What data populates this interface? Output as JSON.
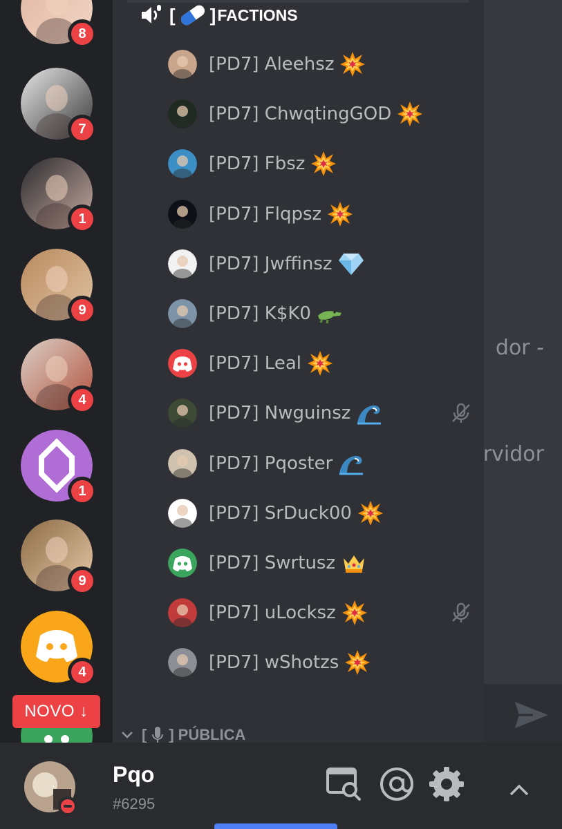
{
  "servers": [
    {
      "name": "server-1",
      "badge": "8",
      "colors": [
        "#e0b6a0",
        "#f3d7c8"
      ]
    },
    {
      "name": "server-2",
      "badge": "7",
      "colors": [
        "#e6e6e6",
        "#3a3a3a"
      ]
    },
    {
      "name": "server-3",
      "badge": "1",
      "colors": [
        "#2a2a2e",
        "#c7aaa0"
      ]
    },
    {
      "name": "server-4",
      "badge": "9",
      "colors": [
        "#b88a5e",
        "#e0c2a2"
      ]
    },
    {
      "name": "server-5",
      "badge": "4",
      "colors": [
        "#d9cfc6",
        "#b3533e"
      ]
    },
    {
      "name": "server-6",
      "badge": "1",
      "colors": [
        "#b06dd6",
        "#c987e6"
      ]
    },
    {
      "name": "server-7",
      "badge": "9",
      "colors": [
        "#8a6b45",
        "#e9c9a8"
      ]
    },
    {
      "name": "server-8",
      "badge": "4",
      "colors": [
        "#faa61a",
        "#faa61a"
      ]
    }
  ],
  "novo_label": "NOVO ↓",
  "channel": {
    "name": "FACTIONS"
  },
  "members": [
    {
      "name": "[PD7] Aleehsz",
      "emoji": "collision",
      "avatar": "#c9a58c",
      "muted": false
    },
    {
      "name": "[PD7] ChwqtingGOD",
      "emoji": "collision",
      "avatar": "#1f2a22",
      "muted": false
    },
    {
      "name": "[PD7] Fbsz",
      "emoji": "collision",
      "avatar": "#3b8fc4",
      "muted": false
    },
    {
      "name": "[PD7] Flqpsz",
      "emoji": "collision",
      "avatar": "#0d1117",
      "muted": false
    },
    {
      "name": "[PD7] Jwffinsz",
      "emoji": "gem",
      "avatar": "#f2f2f2",
      "muted": false
    },
    {
      "name": "[PD7] K$K0",
      "emoji": "crocodile",
      "avatar": "#7c93a8",
      "muted": false
    },
    {
      "name": "[PD7] Leal",
      "emoji": "collision",
      "avatar": "#ed4245",
      "muted": false
    },
    {
      "name": "[PD7] Nwguinsz",
      "emoji": "wave",
      "avatar": "#3d4a35",
      "muted": true
    },
    {
      "name": "[PD7] Pqoster",
      "emoji": "wave",
      "avatar": "#cfc3b0",
      "muted": false
    },
    {
      "name": "[PD7] SrDuck00",
      "emoji": "collision",
      "avatar": "#ffffff",
      "muted": false
    },
    {
      "name": "[PD7] Swrtusz",
      "emoji": "crown",
      "avatar": "#3ba55d",
      "muted": false
    },
    {
      "name": "[PD7] uLocksz",
      "emoji": "collision",
      "avatar": "#c23b3b",
      "muted": true
    },
    {
      "name": "[PD7] wShotzs",
      "emoji": "collision",
      "avatar": "#8d8f96",
      "muted": false
    }
  ],
  "next_category": {
    "name": "PÚBLICA"
  },
  "chat_fragments": [
    "dor -",
    "rvidor"
  ],
  "user": {
    "name": "Pqo",
    "tag": "#6295"
  },
  "colors": {
    "accent": "#5865f2",
    "badge": "#ed4245",
    "online": "#3ba55d"
  }
}
